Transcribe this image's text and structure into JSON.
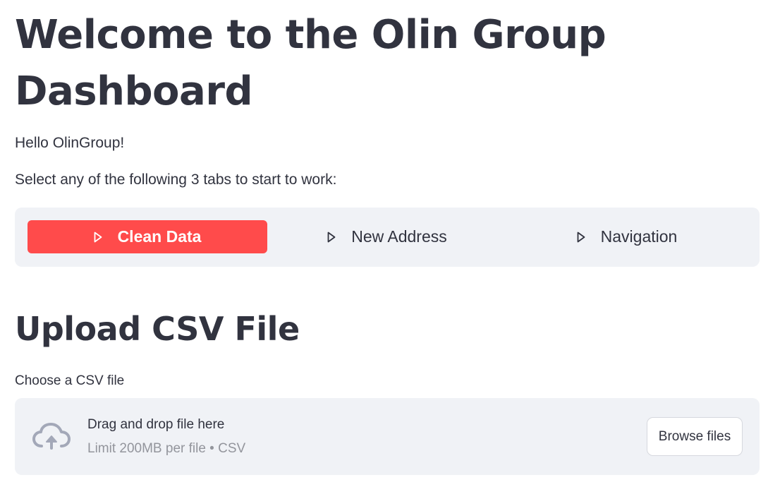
{
  "page": {
    "title": "Welcome to the Olin Group Dashboard",
    "greeting": "Hello OlinGroup!",
    "instruction": "Select any of the following 3 tabs to start to work:"
  },
  "tabs": [
    {
      "label": "Clean Data",
      "icon": "play-outline-icon",
      "active": true
    },
    {
      "label": "New Address",
      "icon": "play-outline-icon",
      "active": false
    },
    {
      "label": "Navigation",
      "icon": "play-outline-icon",
      "active": false
    }
  ],
  "upload": {
    "section_title": "Upload CSV File",
    "label": "Choose a CSV file",
    "drop_text": "Drag and drop file here",
    "limit_text": "Limit 200MB per file • CSV",
    "browse_label": "Browse files",
    "icon": "cloud-upload-icon"
  },
  "colors": {
    "accent": "#ff4b4b",
    "text": "#31333f",
    "panel": "#f0f2f6",
    "muted": "#93959c",
    "icon": "#a3a8b8"
  }
}
